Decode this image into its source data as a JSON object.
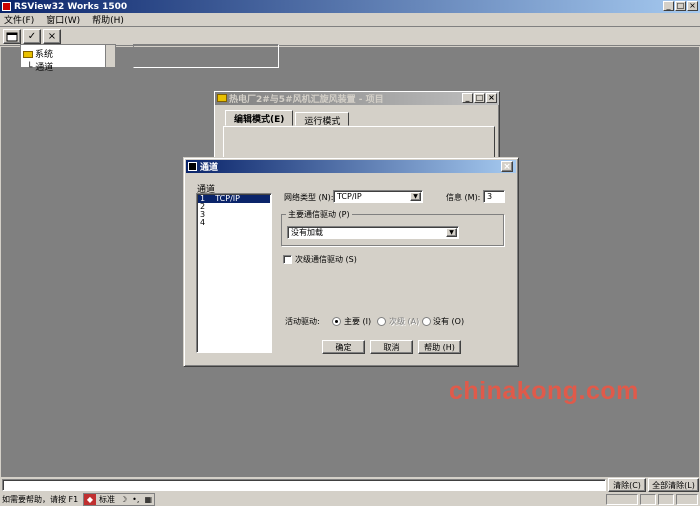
{
  "app": {
    "title": "RSView32 Works 1500",
    "window_buttons": [
      "_",
      "□",
      "×"
    ]
  },
  "menu": [
    "文件(F)",
    "窗口(W)",
    "帮助(H)"
  ],
  "toolbar": {
    "btn_check": "✓",
    "btn_cancel": "×"
  },
  "project_window": {
    "title": "热电厂2#与5#风机汇旋风装置 - 项目",
    "tabs": [
      "编辑模式(E)",
      "运行模式"
    ],
    "tree_items": [
      "系统",
      "通道"
    ]
  },
  "dialog": {
    "title": "通道",
    "channel_label": "通道",
    "channels": [
      {
        "num": "1",
        "name": "TCP/IP"
      },
      {
        "num": "2",
        "name": ""
      },
      {
        "num": "3",
        "name": ""
      },
      {
        "num": "4",
        "name": ""
      }
    ],
    "network_type_label": "网络类型 (N):",
    "network_type_value": "TCP/IP",
    "info_label": "信息 (M):",
    "info_value": "3",
    "primary_driver_label": "主要通信驱动 (P)",
    "primary_driver_value": "没有加载",
    "secondary_checkbox_label": "次级通信驱动 (S)",
    "active_driver_label": "活动驱动:",
    "radio_primary": "主要 (I)",
    "radio_secondary": "次级 (A)",
    "radio_none": "没有 (O)",
    "ok": "确定",
    "cancel": "取消",
    "help": "帮助 (H)"
  },
  "watermark": "chinakong.com",
  "bottom": {
    "clear": "清除(C)",
    "clear_all": "全部清除(L)",
    "status": "如需要帮助，请按 F1",
    "ime_mode": "标准"
  }
}
